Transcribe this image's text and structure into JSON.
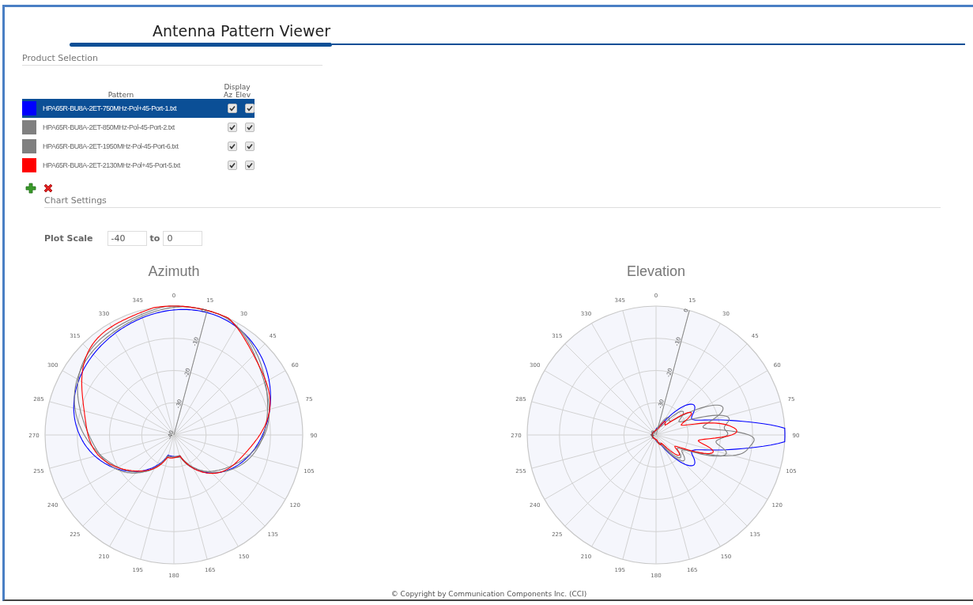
{
  "title": "Antenna Pattern Viewer",
  "product_selection": {
    "heading": "Product Selection",
    "pattern_header": "Pattern",
    "display_header": "Display",
    "az_header": "Az",
    "elev_header": "Elev",
    "patterns": [
      {
        "name": "HPA65R-BU8A-2ET-750MHz-Pol+45-Port-1.txt",
        "color": "#0000ff",
        "selected": true,
        "az": true,
        "elev": true
      },
      {
        "name": "HPA65R-BU8A-2ET-850MHz-Pol-45-Port-2.txt",
        "color": "#808080",
        "selected": false,
        "az": true,
        "elev": true
      },
      {
        "name": "HPA65R-BU8A-2ET-1950MHz-Pol-45-Port-6.txt",
        "color": "#808080",
        "selected": false,
        "az": true,
        "elev": true
      },
      {
        "name": "HPA65R-BU8A-2ET-2130MHz-Pol+45-Port-5.txt",
        "color": "#ff0000",
        "selected": false,
        "az": true,
        "elev": true
      }
    ]
  },
  "chart_settings": {
    "heading": "Chart Settings",
    "plot_scale_label": "Plot Scale",
    "from": "-40",
    "to_label": "to",
    "to": "0"
  },
  "charts": [
    {
      "kind": "azimuth",
      "title": "Azimuth",
      "angular_ticks": [
        "0",
        "15",
        "30",
        "45",
        "60",
        "75",
        "90",
        "105",
        "120",
        "135",
        "150",
        "165",
        "180",
        "195",
        "210",
        "225",
        "240",
        "255",
        "270",
        "285",
        "300",
        "315",
        "330",
        "345"
      ],
      "radial_ticks": [
        "0",
        "-10",
        "-20",
        "-30",
        "-40"
      ]
    },
    {
      "kind": "elevation",
      "title": "Elevation",
      "angular_ticks": [
        "0",
        "15",
        "30",
        "45",
        "60",
        "75",
        "90",
        "105",
        "120",
        "135",
        "150",
        "165",
        "180",
        "195",
        "210",
        "225",
        "240",
        "255",
        "270",
        "285",
        "300",
        "315",
        "330",
        "345"
      ],
      "radial_ticks": [
        "0",
        "-10",
        "-20",
        "-30",
        "-40"
      ]
    }
  ],
  "footer": "© Copyright by Communication Components Inc. (CCI)"
}
